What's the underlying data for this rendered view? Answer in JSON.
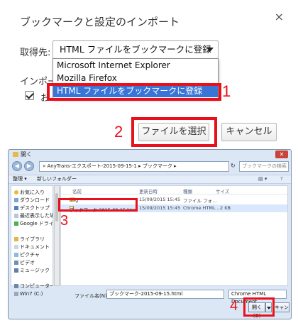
{
  "import_dialog": {
    "title": "ブックマークと設定のインポート",
    "close_glyph": "×",
    "source_label": "取得先:",
    "selected_source": "HTML ファイルをブックマークに登録",
    "options": [
      "Microsoft Internet Explorer",
      "Mozilla Firefox",
      "HTML ファイルをブックマークに登録"
    ],
    "import_label": "インポー",
    "checkbox_label": "お",
    "choose_file_button": "ファイルを選択",
    "cancel_button": "キャンセル"
  },
  "annotations": {
    "one": "1",
    "two": "2",
    "three": "3",
    "four": "4",
    "color": "#e8101a"
  },
  "file_dialog": {
    "title": "開く",
    "address": "« AnyTrans-エクスポート-2015-09-15-1 ▸ ブックマーク ▸",
    "search_placeholder": "ブックマークの検索",
    "toolbar": {
      "organize": "整理 ▾",
      "new_folder": "新しいフォルダー"
    },
    "nav_items": [
      "お気に入り",
      "ダウンロード",
      "デスクトップ",
      "最近表示した場",
      "Google ドライ",
      "",
      "ライブラリ",
      "ドキュメント",
      "ピクチャ",
      "ビデオ",
      "ミュージック",
      "",
      "コンピューター",
      "Win7 (C:)"
    ],
    "columns": {
      "name": "名前",
      "date": "更新日時",
      "type": "種類",
      "size": "サイズ"
    },
    "rows": [
      {
        "name": "img",
        "date": "15/09/2015 15:45",
        "type": "ファイル フォ...",
        "size": ""
      },
      {
        "name": "ブックマーク-2015-09-15.html",
        "date": "15/09/2015 15:45",
        "type": "Chrome HTML ...",
        "size": "2 KB"
      }
    ],
    "filename_label": "ファイル名(N):",
    "filename_value": "ブックマーク-2015-09-15.html",
    "filetype_value": "Chrome HTML Document",
    "open_button": "開く(O)",
    "cancel_button": "キャンセル"
  }
}
